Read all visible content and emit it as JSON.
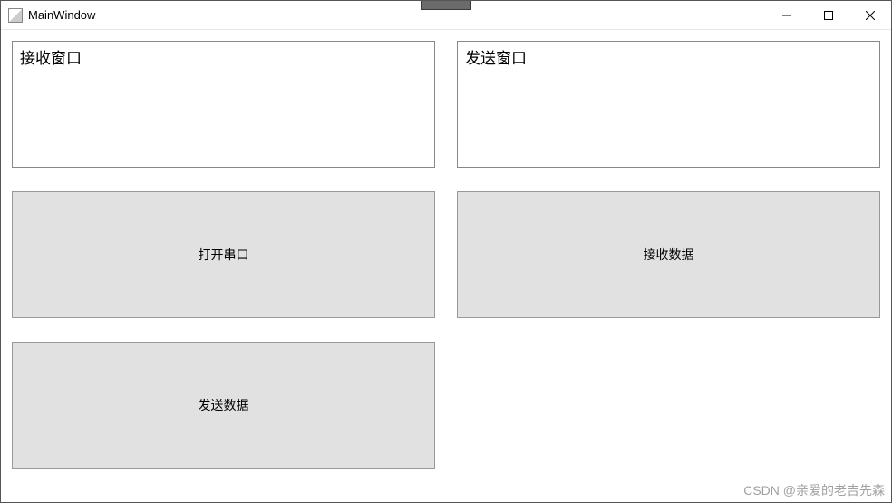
{
  "window": {
    "title": "MainWindow"
  },
  "panels": {
    "receive_label": "接收窗口",
    "send_label": "发送窗口"
  },
  "buttons": {
    "open_serial": "打开串口",
    "receive_data": "接收数据",
    "send_data": "发送数据"
  },
  "watermark": "CSDN @亲爱的老吉先森"
}
